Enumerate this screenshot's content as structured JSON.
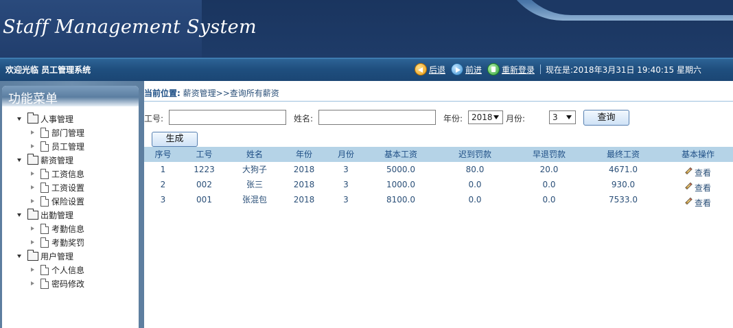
{
  "header": {
    "logo_text": "Staff Management System"
  },
  "topbar": {
    "welcome": "欢迎光临 员工管理系统",
    "back_label": "后退",
    "forward_label": "前进",
    "relogin_label": "重新登录",
    "now_text": "现在是:2018年3月31日 19:40:15 星期六"
  },
  "sidebar": {
    "title": "功能菜单",
    "groups": [
      {
        "label": "人事管理",
        "items": [
          "部门管理",
          "员工管理"
        ]
      },
      {
        "label": "薪资管理",
        "items": [
          "工资信息",
          "工资设置",
          "保险设置"
        ]
      },
      {
        "label": "出勤管理",
        "items": [
          "考勤信息",
          "考勤奖罚"
        ]
      },
      {
        "label": "用户管理",
        "items": [
          "个人信息",
          "密码修改"
        ]
      }
    ]
  },
  "breadcrumb": {
    "label": "当前位置:",
    "path": "薪资管理>>查询所有薪资"
  },
  "search": {
    "emp_no_label": "工号:",
    "emp_no_value": "",
    "name_label": "姓名:",
    "name_value": "",
    "year_label": "年份:",
    "year_value": "2018",
    "month_label": "月份:",
    "month_value": "3",
    "query_label": "查询"
  },
  "generate_label": "生成",
  "table": {
    "headers": [
      "序号",
      "工号",
      "姓名",
      "年份",
      "月份",
      "基本工资",
      "迟到罚款",
      "早退罚款",
      "最终工资",
      "基本操作"
    ],
    "rows": [
      [
        "1",
        "1223",
        "大狗子",
        "2018",
        "3",
        "5000.0",
        "80.0",
        "20.0",
        "4671.0",
        "查看"
      ],
      [
        "2",
        "002",
        "张三",
        "2018",
        "3",
        "1000.0",
        "0.0",
        "0.0",
        "930.0",
        "查看"
      ],
      [
        "3",
        "001",
        "张混包",
        "2018",
        "3",
        "8100.0",
        "0.0",
        "0.0",
        "7533.0",
        "查看"
      ]
    ]
  }
}
